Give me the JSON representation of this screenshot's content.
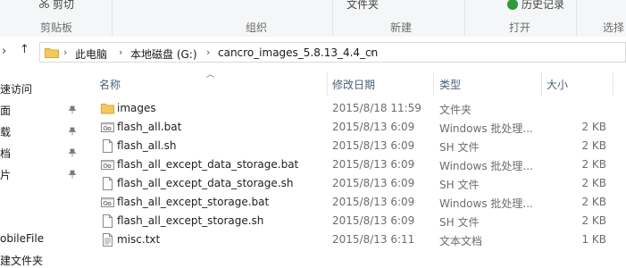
{
  "ribbon": {
    "cut": "剪切",
    "clipboard_group": "剪贴板",
    "organize_group": "组织",
    "folder": "文件夹",
    "new_group": "新建",
    "history": "历史记录",
    "open_group": "打开",
    "select_group": "选择"
  },
  "address": {
    "crumbs": [
      "此电脑",
      "本地磁盘 (G:)",
      "cancro_images_5.8.13_4.4_cn"
    ]
  },
  "nav": {
    "items": [
      {
        "label": "速访问"
      },
      {
        "label": "面"
      },
      {
        "label": "载"
      },
      {
        "label": "档"
      },
      {
        "label": "片"
      },
      {
        "label": "obileFile"
      },
      {
        "label": "建文件夹"
      }
    ]
  },
  "columns": {
    "name": "名称",
    "date": "修改日期",
    "type": "类型",
    "size": "大小"
  },
  "files": [
    {
      "name": "images",
      "date": "2015/8/18 11:59",
      "type": "文件夹",
      "size": "",
      "icon": "folder-icon"
    },
    {
      "name": "flash_all.bat",
      "date": "2015/8/13 6:09",
      "type": "Windows 批处理...",
      "size": "2 KB",
      "icon": "batch-file-icon"
    },
    {
      "name": "flash_all.sh",
      "date": "2015/8/13 6:09",
      "type": "SH 文件",
      "size": "2 KB",
      "icon": "file-icon"
    },
    {
      "name": "flash_all_except_data_storage.bat",
      "date": "2015/8/13 6:09",
      "type": "Windows 批处理...",
      "size": "2 KB",
      "icon": "batch-file-icon"
    },
    {
      "name": "flash_all_except_data_storage.sh",
      "date": "2015/8/13 6:09",
      "type": "SH 文件",
      "size": "2 KB",
      "icon": "file-icon"
    },
    {
      "name": "flash_all_except_storage.bat",
      "date": "2015/8/13 6:09",
      "type": "Windows 批处理...",
      "size": "2 KB",
      "icon": "batch-file-icon"
    },
    {
      "name": "flash_all_except_storage.sh",
      "date": "2015/8/13 6:09",
      "type": "SH 文件",
      "size": "2 KB",
      "icon": "file-icon"
    },
    {
      "name": "misc.txt",
      "date": "2015/8/13 6:11",
      "type": "文本文档",
      "size": "1 KB",
      "icon": "text-file-icon"
    }
  ]
}
